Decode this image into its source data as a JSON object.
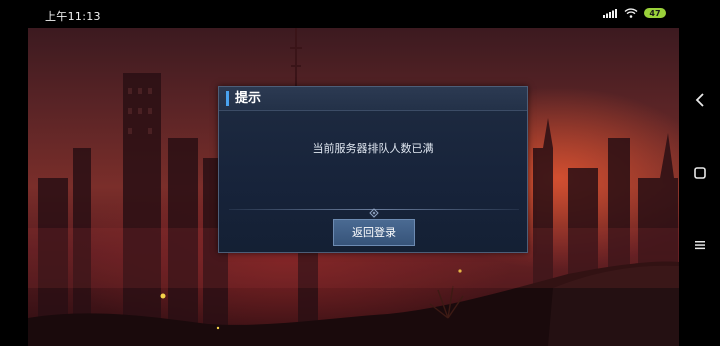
{
  "status_bar": {
    "time": "上午11:13",
    "battery": "47",
    "icons": [
      "signal-icon",
      "wifi-icon",
      "battery-icon"
    ]
  },
  "dialog": {
    "title": "提示",
    "message": "当前服务器排队人数已满",
    "button_label": "返回登录"
  },
  "nav_bar": {
    "icons": [
      "back-chevron-icon",
      "home-square-icon",
      "menu-icon"
    ]
  },
  "colors": {
    "dialog_bg": "#1b273d",
    "title_accent": "#4aa3f0",
    "button_bg": "#3f5e86",
    "battery": "#9ad13a"
  }
}
